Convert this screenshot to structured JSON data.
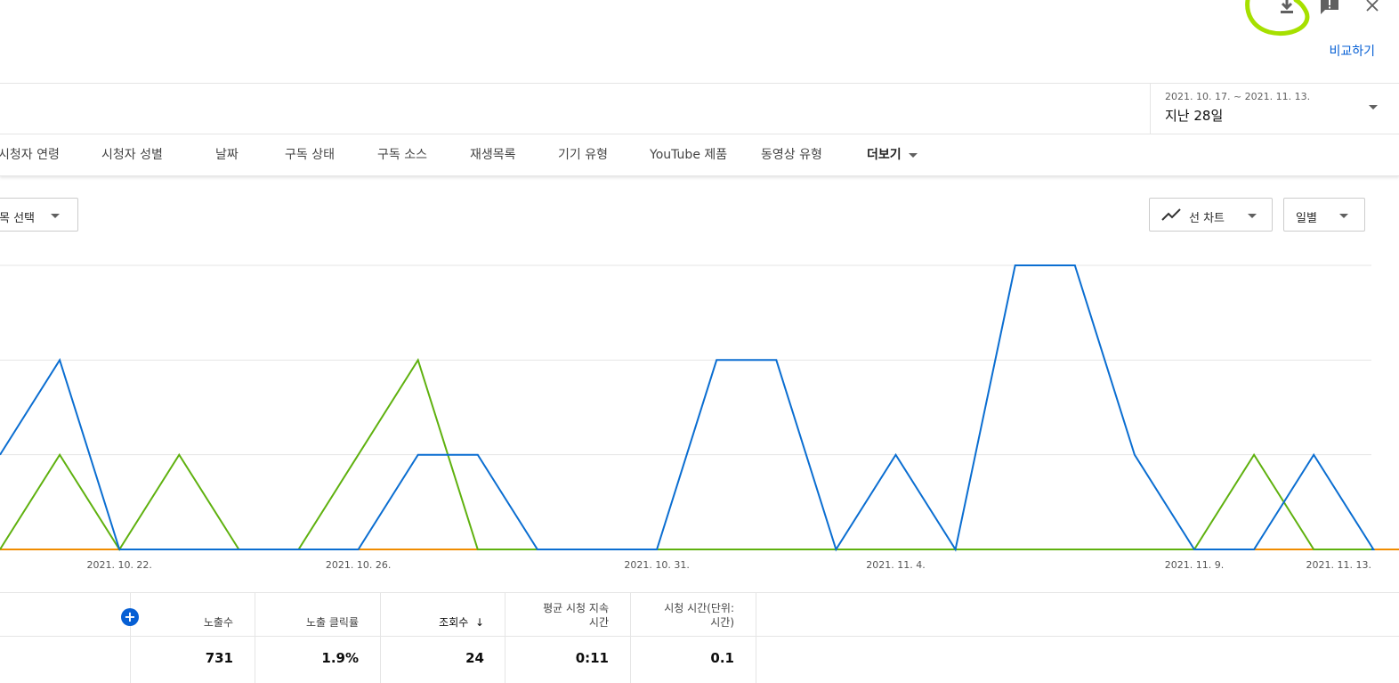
{
  "header": {
    "icons": [
      "download-icon",
      "feedback-icon",
      "close-icon"
    ],
    "compare_label": "비교하기"
  },
  "date_range": {
    "range": "2021. 10. 17. ~ 2021. 11. 13.",
    "label": "지난 28일"
  },
  "tabs": [
    {
      "label": "시청자 연령"
    },
    {
      "label": "시청자 성별"
    },
    {
      "label": "날짜"
    },
    {
      "label": "구독 상태"
    },
    {
      "label": "구독 소스"
    },
    {
      "label": "재생목록"
    },
    {
      "label": "기기 유형"
    },
    {
      "label": "YouTube 제품"
    },
    {
      "label": "동영상 유형"
    },
    {
      "label": "더보기"
    }
  ],
  "controls": {
    "left_select": "목 선택",
    "chart_type": "선 차트",
    "granularity": "일별"
  },
  "colors": {
    "series_blue": "#0b6ed1",
    "series_green": "#5fb10f",
    "series_orange": "#f08c00",
    "accent": "#065fd4",
    "highlight": "#a6e000"
  },
  "chart_data": {
    "type": "line",
    "x": [
      "2021. 10. 20.",
      "2021. 10. 21.",
      "2021. 10. 22.",
      "2021. 10. 23.",
      "2021. 10. 24.",
      "2021. 10. 25.",
      "2021. 10. 26.",
      "2021. 10. 27.",
      "2021. 10. 28.",
      "2021. 10. 29.",
      "2021. 10. 30.",
      "2021. 10. 31.",
      "2021. 11. 1.",
      "2021. 11. 2.",
      "2021. 11. 3.",
      "2021. 11. 4.",
      "2021. 11. 5.",
      "2021. 11. 6.",
      "2021. 11. 7.",
      "2021. 11. 8.",
      "2021. 11. 9.",
      "2021. 11. 10.",
      "2021. 11. 11.",
      "2021. 11. 12.",
      "2021. 11. 13."
    ],
    "x_tick_labels": [
      "2021. 10. 22.",
      "2021. 10. 26.",
      "2021. 10. 31.",
      "2021. 11. 4.",
      "2021. 11. 9.",
      "2021. 11. 13."
    ],
    "ylim": [
      0,
      3
    ],
    "grid": true,
    "series": [
      {
        "values": [
          1,
          2,
          0,
          0,
          0,
          0,
          0,
          1,
          1,
          0,
          0,
          0,
          2,
          2,
          0,
          1,
          0,
          3,
          3,
          1,
          0,
          0,
          1,
          0,
          null
        ],
        "partial_first": true
      },
      {
        "values": [
          0,
          1,
          0,
          1,
          0,
          0,
          1,
          2,
          0,
          0,
          0,
          0,
          0,
          0,
          0,
          0,
          0,
          0,
          0,
          0,
          0,
          1,
          0,
          0,
          null
        ]
      },
      {
        "values": [
          0,
          0,
          0,
          0,
          0,
          0,
          0,
          0,
          0,
          0,
          0,
          0,
          0,
          0,
          0,
          0,
          0,
          0,
          0,
          0,
          0,
          0,
          0,
          0,
          0
        ]
      }
    ]
  },
  "table": {
    "headers": [
      "노출수",
      "노출 클릭률",
      "조회수",
      "평균 시청 지속\n시간",
      "시청 시간(단위:\n시간)"
    ],
    "sorted_arrow": "↓",
    "add_icon": "+",
    "values": [
      "731",
      "1.9%",
      "24",
      "0:11",
      "0.1"
    ]
  }
}
